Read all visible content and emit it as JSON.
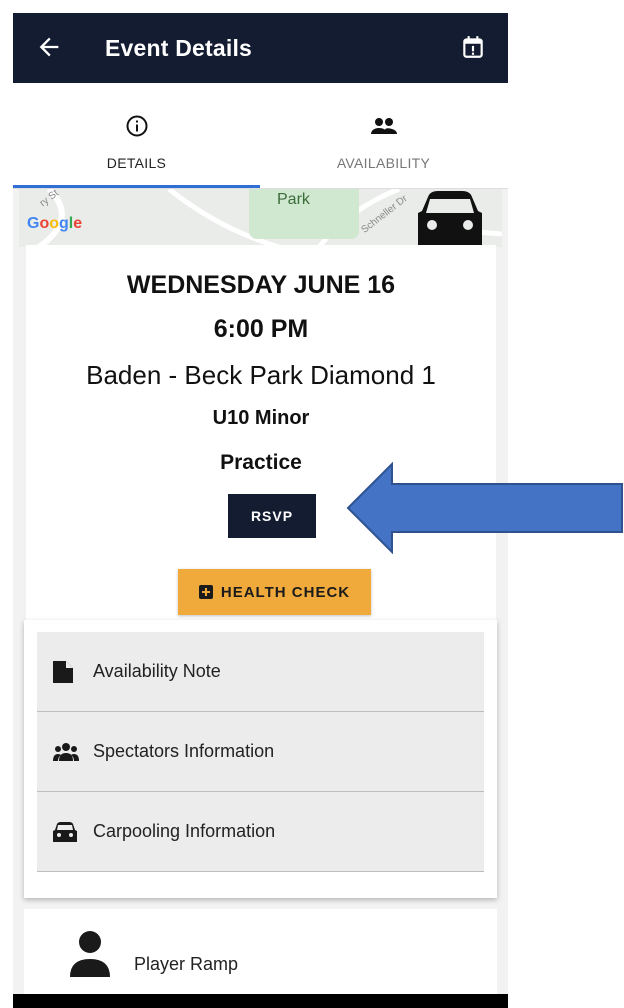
{
  "appbar": {
    "title": "Event Details",
    "back_icon": "arrow-back-icon",
    "calendar_icon": "calendar-alert-icon",
    "bg_color": "#131c30"
  },
  "tabs": [
    {
      "label": "DETAILS",
      "icon": "info-circle-icon",
      "active": true
    },
    {
      "label": "AVAILABILITY",
      "icon": "people-group-icon",
      "active": false
    }
  ],
  "map": {
    "park_label": "Park",
    "google_label": "Google",
    "street_1": "ry St",
    "street_2": "Schneller Dr",
    "car_icon": "car-icon"
  },
  "event": {
    "date": "WEDNESDAY JUNE 16",
    "time": "6:00 PM",
    "location": "Baden - Beck Park Diamond 1",
    "team": "U10 Minor",
    "type": "Practice"
  },
  "buttons": {
    "rsvp_label": "RSVP",
    "health_check_label": "HEALTH CHECK",
    "rsvp_color": "#131c30",
    "health_color": "#f0aa3c"
  },
  "info_rows": [
    {
      "label": "Availability Note",
      "icon": "note-icon"
    },
    {
      "label": "Spectators Information",
      "icon": "people-group-icon"
    },
    {
      "label": "Carpooling Information",
      "icon": "car-icon"
    }
  ],
  "player": {
    "name": "Player Ramp",
    "icon": "person-icon"
  },
  "annotation": {
    "arrow_color": "#4472c4"
  }
}
